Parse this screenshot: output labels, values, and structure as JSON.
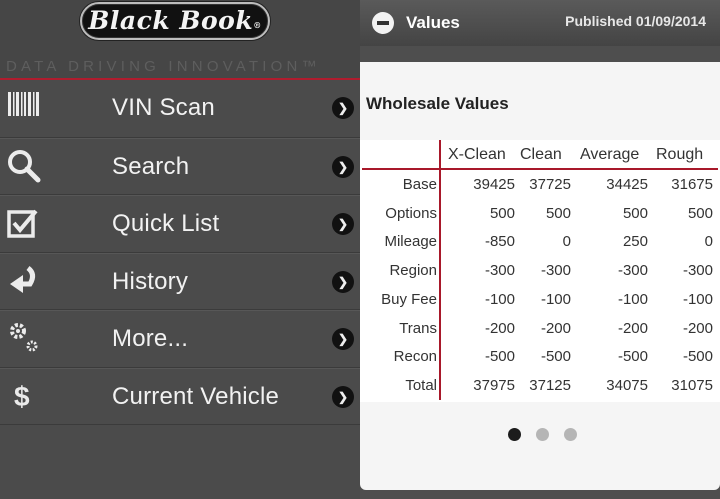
{
  "header": {
    "logo_text": "Black Book",
    "tagline": "DATA DRIVING INNOVATION™"
  },
  "menu": [
    {
      "label": "VIN Scan",
      "icon": "barcode-icon"
    },
    {
      "label": "Search",
      "icon": "search-icon"
    },
    {
      "label": "Quick List",
      "icon": "checkbox-icon"
    },
    {
      "label": "History",
      "icon": "return-arrow-icon"
    },
    {
      "label": "More...",
      "icon": "gears-icon"
    },
    {
      "label": "Current Vehicle",
      "icon": "dollar-icon"
    }
  ],
  "panel": {
    "title": "Values",
    "published": "Published 01/09/2014",
    "section_title": "Wholesale Values"
  },
  "table": {
    "columns": [
      "X-Clean",
      "Clean",
      "Average",
      "Rough"
    ],
    "rows": [
      {
        "label": "Base",
        "values": [
          "39425",
          "37725",
          "34425",
          "31675"
        ]
      },
      {
        "label": "Options",
        "values": [
          "500",
          "500",
          "500",
          "500"
        ]
      },
      {
        "label": "Mileage",
        "values": [
          "-850",
          "0",
          "250",
          "0"
        ]
      },
      {
        "label": "Region",
        "values": [
          "-300",
          "-300",
          "-300",
          "-300"
        ]
      },
      {
        "label": "Buy Fee",
        "values": [
          "-100",
          "-100",
          "-100",
          "-100"
        ]
      },
      {
        "label": "Trans",
        "values": [
          "-200",
          "-200",
          "-200",
          "-200"
        ]
      },
      {
        "label": "Recon",
        "values": [
          "-500",
          "-500",
          "-500",
          "-500"
        ]
      },
      {
        "label": "Total",
        "values": [
          "37975",
          "37125",
          "34075",
          "31075"
        ]
      }
    ]
  },
  "pager": {
    "count": 3,
    "active": 0
  },
  "colors": {
    "accent": "#b01c2e",
    "panel": "#4b4b4b",
    "card": "#f5f5f5"
  }
}
